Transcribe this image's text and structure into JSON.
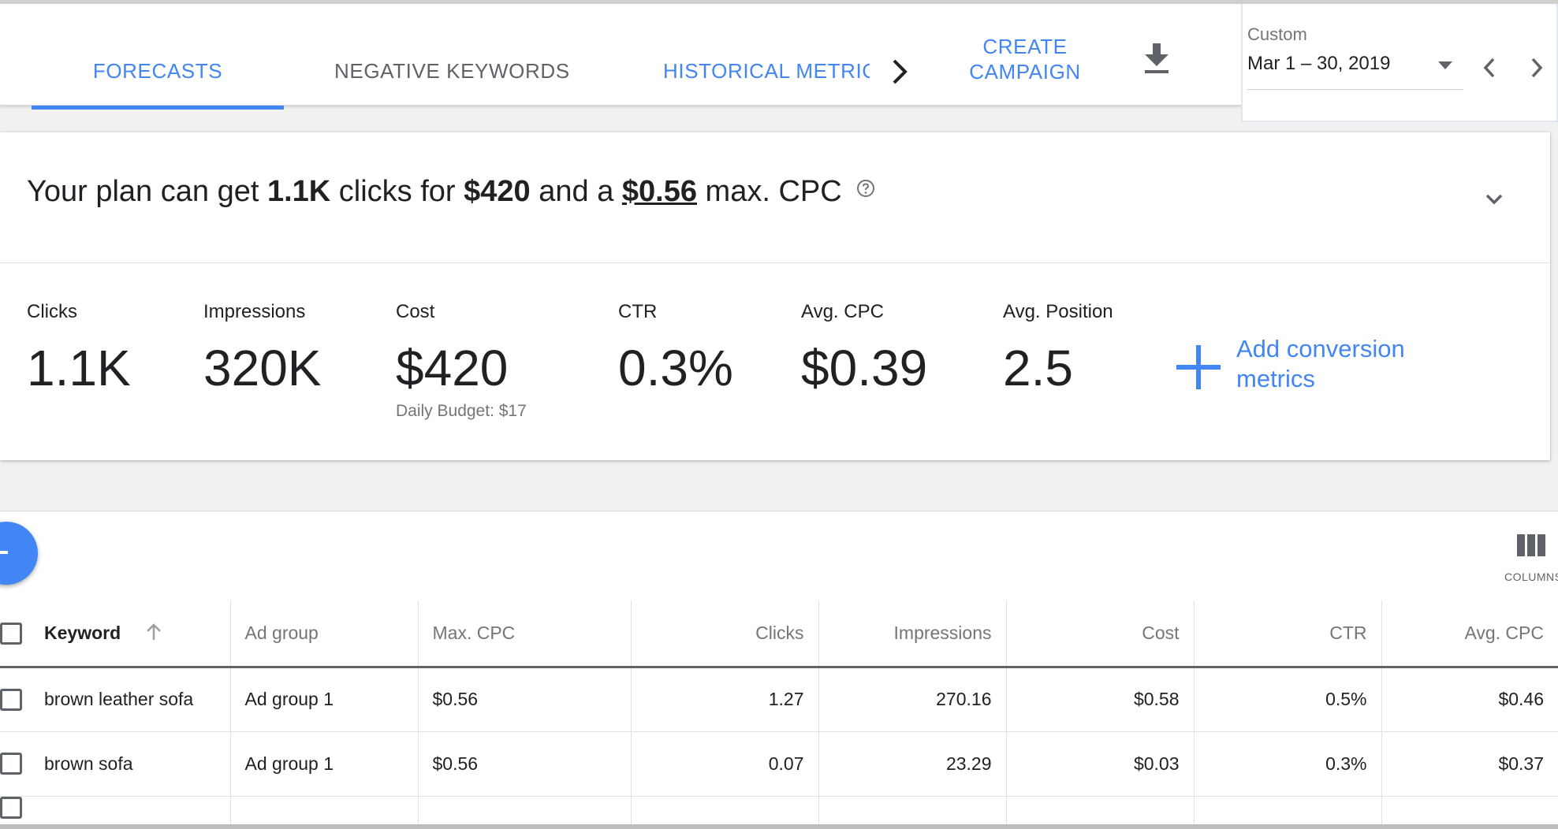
{
  "tabs": {
    "forecasts": "FORECASTS",
    "negative_keywords": "NEGATIVE KEYWORDS",
    "historical_metrics": "HISTORICAL METRICS"
  },
  "toolbar": {
    "create_campaign_line1": "CREATE",
    "create_campaign_line2": "CAMPAIGN",
    "download_icon": "download-icon",
    "scroll_icon": "chevron-right-icon"
  },
  "date_range": {
    "label": "Custom",
    "value": "Mar 1 – 30, 2019"
  },
  "summary": {
    "prefix": "Your plan can get ",
    "clicks": "1.1K",
    "mid1": " clicks for ",
    "cost": "$420",
    "mid2": " and a ",
    "max_cpc": "$0.56",
    "suffix": " max. CPC"
  },
  "metrics": [
    {
      "label": "Clicks",
      "value": "1.1K"
    },
    {
      "label": "Impressions",
      "value": "320K"
    },
    {
      "label": "Cost",
      "value": "$420",
      "sub": "Daily Budget: $17"
    },
    {
      "label": "CTR",
      "value": "0.3%"
    },
    {
      "label": "Avg. CPC",
      "value": "$0.39"
    },
    {
      "label": "Avg. Position",
      "value": "2.5"
    }
  ],
  "add_conversion": {
    "line1": "Add conversion",
    "line2": "metrics"
  },
  "columns_label": "COLUMNS",
  "table": {
    "headers": [
      "Keyword",
      "Ad group",
      "Max. CPC",
      "Clicks",
      "Impressions",
      "Cost",
      "CTR",
      "Avg. CPC"
    ],
    "rows": [
      {
        "keyword": "brown leather sofa",
        "ad_group": "Ad group 1",
        "max_cpc": "$0.56",
        "clicks": "1.27",
        "impressions": "270.16",
        "cost": "$0.58",
        "ctr": "0.5%",
        "avg_cpc": "$0.46"
      },
      {
        "keyword": "brown sofa",
        "ad_group": "Ad group 1",
        "max_cpc": "$0.56",
        "clicks": "0.07",
        "impressions": "23.29",
        "cost": "$0.03",
        "ctr": "0.3%",
        "avg_cpc": "$0.37"
      }
    ]
  },
  "colors": {
    "accent": "#4285f4",
    "text": "#202124",
    "muted": "#757575"
  }
}
